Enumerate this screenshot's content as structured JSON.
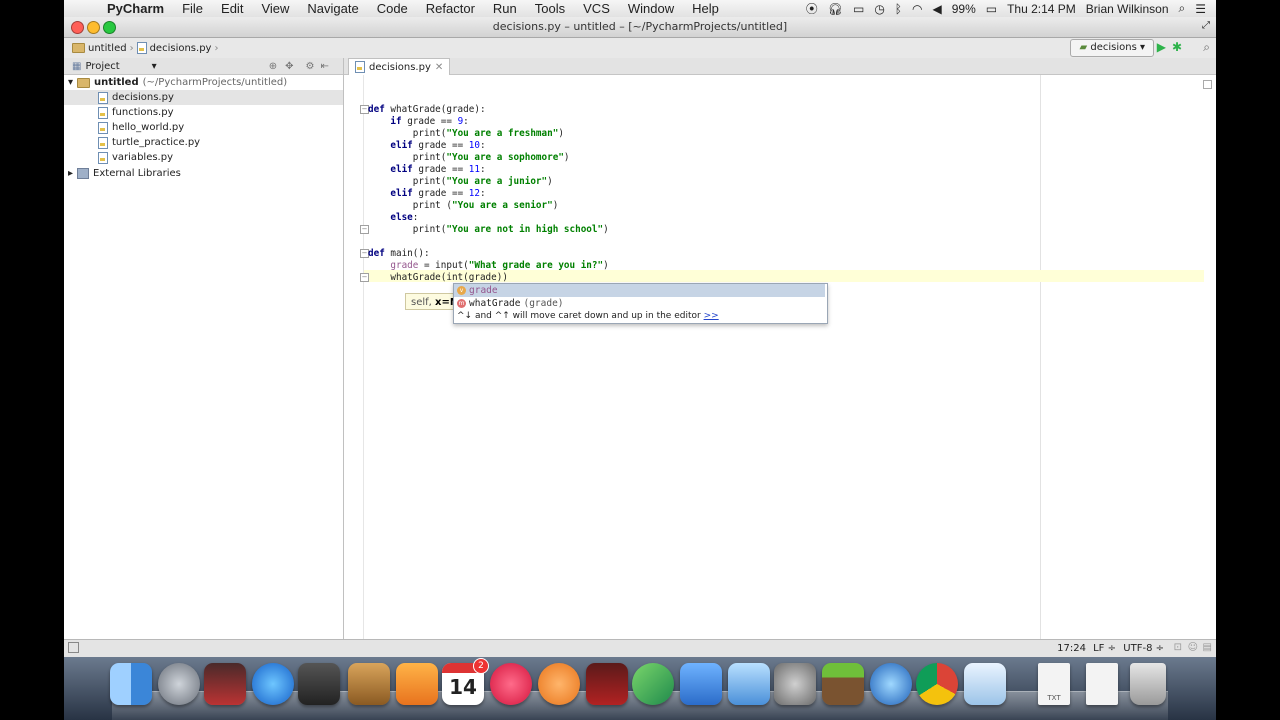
{
  "menubar": {
    "app_name": "PyCharm",
    "items": [
      "File",
      "Edit",
      "View",
      "Navigate",
      "Code",
      "Refactor",
      "Run",
      "Tools",
      "VCS",
      "Window",
      "Help"
    ],
    "battery": "99%",
    "clock": "Thu 2:14 PM",
    "user": "Brian Wilkinson"
  },
  "window": {
    "title": "decisions.py – untitled – [~/PycharmProjects/untitled]"
  },
  "breadcrumb": {
    "project": "untitled",
    "file": "decisions.py"
  },
  "toolbar": {
    "run_config": "decisions"
  },
  "project_panel": {
    "header": "Project",
    "root_label": "untitled",
    "root_path": "(~/PycharmProjects/untitled)",
    "files": [
      "decisions.py",
      "functions.py",
      "hello_world.py",
      "turtle_practice.py",
      "variables.py"
    ],
    "external": "External Libraries"
  },
  "editor": {
    "tab_label": "decisions.py",
    "lines": [
      {
        "tokens": [
          {
            "t": "def ",
            "c": "kw"
          },
          {
            "t": "whatGrade(grade):",
            "c": ""
          }
        ]
      },
      {
        "tokens": [
          {
            "t": "    ",
            "c": ""
          },
          {
            "t": "if ",
            "c": "kw"
          },
          {
            "t": "grade == ",
            "c": ""
          },
          {
            "t": "9",
            "c": "num"
          },
          {
            "t": ":",
            "c": ""
          }
        ]
      },
      {
        "tokens": [
          {
            "t": "        print(",
            "c": ""
          },
          {
            "t": "\"You are a freshman\"",
            "c": "str"
          },
          {
            "t": ")",
            "c": ""
          }
        ]
      },
      {
        "tokens": [
          {
            "t": "    ",
            "c": ""
          },
          {
            "t": "elif ",
            "c": "kw"
          },
          {
            "t": "grade == ",
            "c": ""
          },
          {
            "t": "10",
            "c": "num"
          },
          {
            "t": ":",
            "c": ""
          }
        ]
      },
      {
        "tokens": [
          {
            "t": "        print(",
            "c": ""
          },
          {
            "t": "\"You are a sophomore\"",
            "c": "str"
          },
          {
            "t": ")",
            "c": ""
          }
        ]
      },
      {
        "tokens": [
          {
            "t": "    ",
            "c": ""
          },
          {
            "t": "elif ",
            "c": "kw"
          },
          {
            "t": "grade == ",
            "c": ""
          },
          {
            "t": "11",
            "c": "num"
          },
          {
            "t": ":",
            "c": ""
          }
        ]
      },
      {
        "tokens": [
          {
            "t": "        print(",
            "c": ""
          },
          {
            "t": "\"You are a junior\"",
            "c": "str"
          },
          {
            "t": ")",
            "c": ""
          }
        ]
      },
      {
        "tokens": [
          {
            "t": "    ",
            "c": ""
          },
          {
            "t": "elif ",
            "c": "kw"
          },
          {
            "t": "grade == ",
            "c": ""
          },
          {
            "t": "12",
            "c": "num"
          },
          {
            "t": ":",
            "c": ""
          }
        ]
      },
      {
        "tokens": [
          {
            "t": "        print (",
            "c": ""
          },
          {
            "t": "\"You are a senior\"",
            "c": "str"
          },
          {
            "t": ")",
            "c": ""
          }
        ]
      },
      {
        "tokens": [
          {
            "t": "    ",
            "c": ""
          },
          {
            "t": "else",
            "c": "kw"
          },
          {
            "t": ":",
            "c": ""
          }
        ]
      },
      {
        "tokens": [
          {
            "t": "        print(",
            "c": ""
          },
          {
            "t": "\"You are not in high school\"",
            "c": "str"
          },
          {
            "t": ")",
            "c": ""
          }
        ]
      },
      {
        "tokens": []
      },
      {
        "tokens": [
          {
            "t": "def ",
            "c": "kw"
          },
          {
            "t": "main():",
            "c": ""
          }
        ]
      },
      {
        "tokens": [
          {
            "t": "    ",
            "c": ""
          },
          {
            "t": "grade",
            "c": "var"
          },
          {
            "t": " = input(",
            "c": ""
          },
          {
            "t": "\"What grade are you in?\"",
            "c": "str"
          },
          {
            "t": ")",
            "c": ""
          }
        ]
      },
      {
        "tokens": [
          {
            "t": "    whatGrade(int(grade))",
            "c": ""
          }
        ]
      }
    ]
  },
  "param_hint": {
    "prefix": "self, ",
    "bold": "x=N"
  },
  "completion": {
    "items": [
      {
        "icon": "v",
        "text": "grade",
        "selected": true
      },
      {
        "icon": "m",
        "text": "whatGrade",
        "suffix": "(grade)",
        "selected": false
      }
    ],
    "hint": "^↓ and ^↑ will move caret down and up in the editor",
    "hint_link": ">>"
  },
  "statusbar": {
    "position": "17:24",
    "line_sep": "LF ÷",
    "encoding": "UTF-8 ÷"
  },
  "dock": {
    "icons": [
      "finder",
      "launchpad",
      "photo-booth",
      "app-store",
      "facetime",
      "contacts",
      "pages",
      "calendar",
      "itunes",
      "ibooks",
      "photo-slideshow",
      "pycharm",
      "xcode",
      "iphoto",
      "system-preferences",
      "minecraft",
      "quicktime",
      "chrome",
      "preview",
      "text-file",
      "document",
      "trash"
    ],
    "calendar_day": "14",
    "calendar_badge": "2",
    "txt_label": "TXT"
  },
  "colors": {
    "keyword": "#000080",
    "string": "#008000",
    "number": "#0000ff",
    "caret_line": "#ffffd7",
    "selection": "#c6d4e5"
  }
}
